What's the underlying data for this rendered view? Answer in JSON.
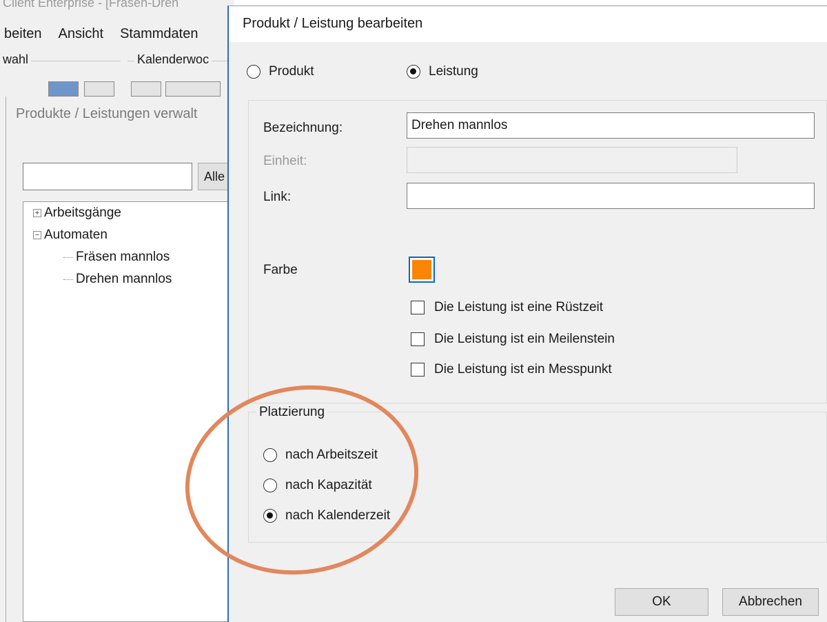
{
  "background_window": {
    "title": "Client Enterprise - [Fräsen-Dreh",
    "menu": [
      "beiten",
      "Ansicht",
      "Stammdaten"
    ],
    "group_left_label": "wahl",
    "group_right_label": "Kalenderwoc",
    "subwindow": {
      "title": "Produkte / Leistungen verwalt",
      "search_value": "",
      "alle_button": "Alle",
      "tree": [
        {
          "label": "Arbeitsgänge",
          "expander": "+"
        },
        {
          "label": "Automaten",
          "expander": "−"
        },
        {
          "label": "Fräsen mannlos"
        },
        {
          "label": "Drehen mannlos"
        }
      ]
    }
  },
  "dialog": {
    "title": "Produkt / Leistung bearbeiten",
    "type_options": [
      {
        "label": "Produkt",
        "checked": false
      },
      {
        "label": "Leistung",
        "checked": true
      }
    ],
    "fields": {
      "bezeichnung_label": "Bezeichnung:",
      "bezeichnung_value": "Drehen mannlos",
      "einheit_label": "Einheit:",
      "einheit_value": "",
      "link_label": "Link:",
      "link_value": "",
      "farbe_label": "Farbe",
      "farbe_color": "#fa8507"
    },
    "checkboxes": [
      {
        "label": "Die Leistung ist eine Rüstzeit",
        "checked": false
      },
      {
        "label": "Die Leistung ist ein Meilenstein",
        "checked": false
      },
      {
        "label": "Die Leistung ist ein Messpunkt",
        "checked": false
      }
    ],
    "placement": {
      "label": "Platzierung",
      "options": [
        {
          "label": "nach Arbeitszeit",
          "checked": false
        },
        {
          "label": "nach Kapazität",
          "checked": false
        },
        {
          "label": "nach Kalenderzeit",
          "checked": true
        }
      ]
    },
    "buttons": {
      "ok": "OK",
      "cancel": "Abbrechen"
    }
  },
  "annotation_color": "#e2875c"
}
